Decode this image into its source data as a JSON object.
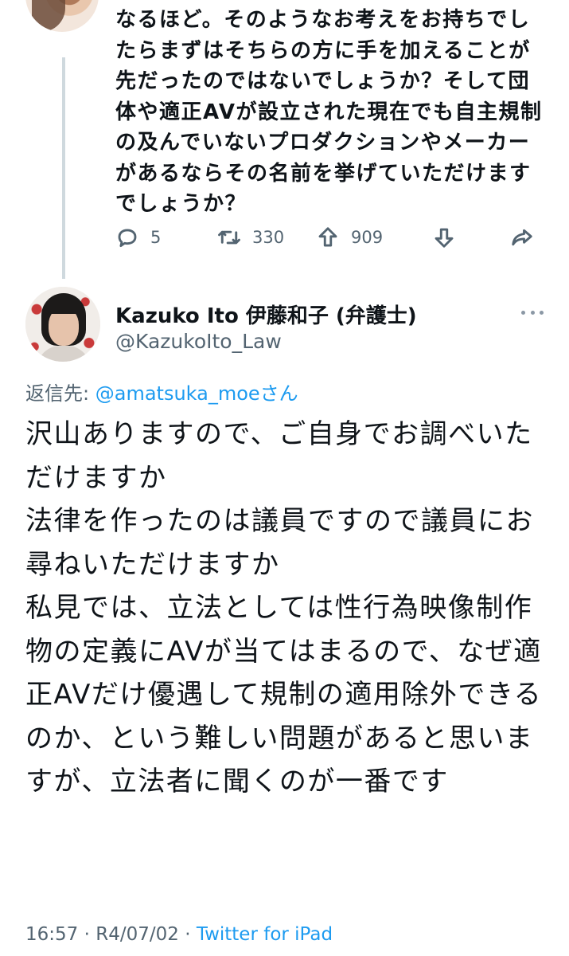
{
  "parent_tweet": {
    "cut_off_line": "",
    "text": "なるほど。そのようなお考えをお持ちでしたらまずはそちらの方に手を加えることが先だったのではないでしょうか？そして団体や適正AVが設立された現在でも自主規制の及んでいないプロダクションやメーカーがあるならその名前を挙げていただけますでしょうか？",
    "actions": {
      "reply_count": "5",
      "retweet_count": "330",
      "upvote_count": "909"
    }
  },
  "tweet": {
    "display_name": "Kazuko Ito 伊藤和子 (弁護士)",
    "handle": "@KazukoIto_Law",
    "reply_label": "返信先:",
    "reply_mention": "@amatsuka_moe",
    "reply_suffix": "さん",
    "text": "沢山ありますので、ご自身でお調べいただけますか\n法律を作ったのは議員ですので議員にお尋ねいただけますか\n私見では、立法としては性行為映像制作物の定義にAVが当てはまるので、なぜ適正AVだけ優遇して規制の適用除外できるのか、という難しい問題があると思いますが、立法者に聞くのが一番です",
    "time": "16:57",
    "separator": "·",
    "date": "R4/07/02",
    "client": "Twitter for iPad"
  },
  "colors": {
    "text": "#0f1419",
    "secondary": "#536471",
    "link": "#1d9bf0",
    "thread_line": "#cfd9de"
  },
  "icons": [
    "reply-icon",
    "retweet-icon",
    "upvote-icon",
    "downvote-icon",
    "share-icon",
    "more-options-icon"
  ]
}
